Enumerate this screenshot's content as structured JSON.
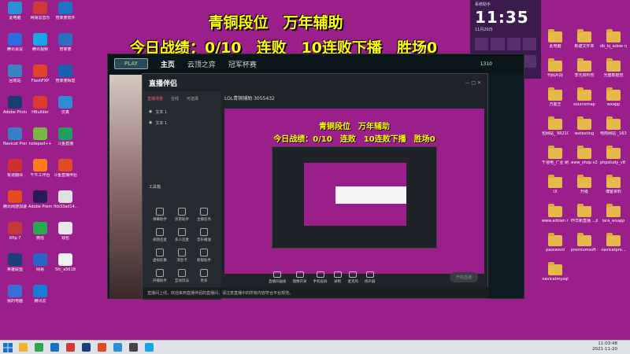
{
  "overlay": {
    "line1": "青铜段位　万年辅助",
    "line2": "今日战绩：0/10　连败　10连败下播　胜场0"
  },
  "desktop_left": [
    {
      "label": "此电脑",
      "color": "#2a8fd6"
    },
    {
      "label": "网易云音乐",
      "color": "#d23838"
    },
    {
      "label": "管家婆软件",
      "color": "#1d74c4"
    },
    {
      "label": "腾讯会议",
      "color": "#2f6be0"
    },
    {
      "label": "腾讯视频",
      "color": "#19a3e8"
    },
    {
      "label": "管家婆",
      "color": "#2a6fc0"
    },
    {
      "label": "回收站",
      "color": "#3b82c4"
    },
    {
      "label": "FlashFXP",
      "color": "#e0442e"
    },
    {
      "label": "管家婆辉煌",
      "color": "#1a5fb0"
    },
    {
      "label": "Adobe Photosh...",
      "color": "#1c3b6e"
    },
    {
      "label": "HBuilder",
      "color": "#d93b2e"
    },
    {
      "label": "仿真",
      "color": "#2e8bd4"
    },
    {
      "label": "Navicat Premium 12",
      "color": "#3a7dc8"
    },
    {
      "label": "notepad++",
      "color": "#7ab648"
    },
    {
      "label": "斗鱼直播",
      "color": "#20a060"
    },
    {
      "label": "有道翻译",
      "color": "#d03030"
    },
    {
      "label": "千牛工作台",
      "color": "#ff7a1a"
    },
    {
      "label": "斗鱼直播伴侣",
      "color": "#e04b24"
    },
    {
      "label": "腾讯网游加速器",
      "color": "#e44b1e"
    },
    {
      "label": "Adobe Premie...",
      "color": "#2b1a5a"
    },
    {
      "label": "fkb33ad14...",
      "color": "#e0e0e0"
    },
    {
      "label": "Xftp 7",
      "color": "#c43a3a"
    },
    {
      "label": "微信",
      "color": "#2aa84a"
    },
    {
      "label": "钱包",
      "color": "#e8e8e8"
    },
    {
      "label": "英雄联盟",
      "color": "#1a3e78"
    },
    {
      "label": "网易",
      "color": "#2c65c8"
    },
    {
      "label": "5fc_a5618",
      "color": "#f0f0f0"
    },
    {
      "label": "我的电脑",
      "color": "#3a6ed8"
    },
    {
      "label": "腾讯云",
      "color": "#1b7ad8"
    }
  ],
  "desktop_right": [
    {
      "label": "此电脑"
    },
    {
      "label": "新建文件夹"
    },
    {
      "label": "db_kj_adow ry_com_20..."
    },
    {
      "label": "代码片段"
    },
    {
      "label": "李元资料包"
    },
    {
      "label": "光盘数据包"
    },
    {
      "label": "万能王"
    },
    {
      "label": "sourcemap"
    },
    {
      "label": "wxapp"
    },
    {
      "label": "包网站_ 992100..."
    },
    {
      "label": "wxtesting"
    },
    {
      "label": "电商网站 _16371956..."
    },
    {
      "label": "千禧电_广业 刷新专..."
    },
    {
      "label": "eww_shop v2"
    },
    {
      "label": "phpstudy_v8 .1.0.1"
    },
    {
      "label": "UI"
    },
    {
      "label": "升级"
    },
    {
      "label": "博客资料"
    },
    {
      "label": "www.adown ry.com_07-2..."
    },
    {
      "label": "昨日新直播 ...jf69.9.4"
    },
    {
      "label": "lara_wxapp"
    },
    {
      "label": "password"
    },
    {
      "label": "premiumsoft 破解 v8.7.1"
    },
    {
      "label": "navicatpre..."
    },
    {
      "label": "navicatmysql"
    }
  ],
  "game": {
    "play": "PLAY",
    "tabs": [
      "主页",
      "云顶之弈",
      "冠军杯赛"
    ],
    "currency": "1310"
  },
  "app": {
    "logo": "直播伴侣",
    "room_title": "LOL青铜辅助 3055432",
    "side_tabs": [
      "直播场景",
      "在线",
      "可选择"
    ],
    "sources": [
      "文本 1",
      "文本 1"
    ],
    "tools_title": "工具箱",
    "tools": [
      "弹幕助手",
      "房管助手",
      "主播任务",
      "视频连麦",
      "多人连麦",
      "音乐播放",
      "虚拟形象",
      "消息卡",
      "新版助手",
      "开播助手",
      "互动玩法",
      "更多"
    ],
    "bottom": [
      "直播间画质",
      "镜像开关",
      "手机投屏",
      "录制",
      "麦克风",
      "扬声器"
    ],
    "start": "开始直播",
    "status": "直播间上线，欢迎来到直播伴侣的直播间，请注意直播中的所有内容符合平台规范。"
  },
  "notif": {
    "title": "系统助手",
    "time": "11:35",
    "date": "11月20日"
  },
  "taskbar": {
    "time": "11:03:48",
    "date": "2021-11-20"
  }
}
